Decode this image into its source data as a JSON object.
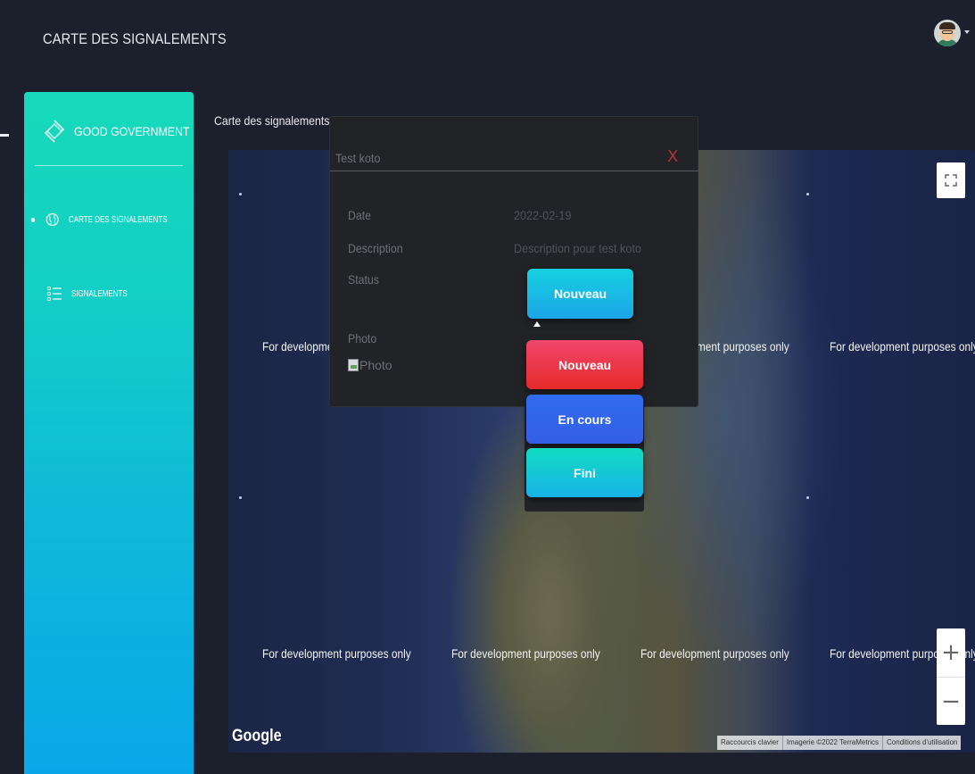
{
  "header": {
    "app_title": "CARTE DES SIGNALEMENTS",
    "avatar_icon": "user-avatar-icon"
  },
  "sidebar": {
    "brand": {
      "label": "GOOD GOVERNMENT",
      "icon": "brand-logo-icon"
    },
    "items": [
      {
        "label": "CARTE DES SIGNALEMENTS",
        "icon": "globe-icon",
        "active": true
      },
      {
        "label": "SIGNALEMENTS",
        "icon": "list-icon",
        "active": false
      }
    ]
  },
  "main": {
    "section_title": "Carte des signalements"
  },
  "map": {
    "watermark": "For development purposes only",
    "google_logo": "Google",
    "attribution": [
      "Raccourcis clavier",
      "Imagerie ©2022 TerraMetrics",
      "Conditions d'utilisation"
    ],
    "zoom_in": "+",
    "zoom_out": "−"
  },
  "popup": {
    "title": "Test koto",
    "close": "X",
    "fields": {
      "date_label": "Date",
      "date_value": "2022-02-19",
      "description_label": "Description",
      "description_value": "Description pour test koto",
      "status_label": "Status",
      "photo_label": "Photo",
      "photo_alt": "Photo"
    },
    "status_current": "Nouveau",
    "status_options": [
      "Nouveau",
      "En cours",
      "Fini"
    ]
  },
  "colors": {
    "background": "#1c1f2c",
    "sidebar_top": "#17d9b9",
    "sidebar_bottom": "#0aa7e8",
    "status_red": "#e52a2a",
    "status_blue": "#345ee6",
    "status_teal": "#12dcc2",
    "close_red": "#b3313a"
  }
}
